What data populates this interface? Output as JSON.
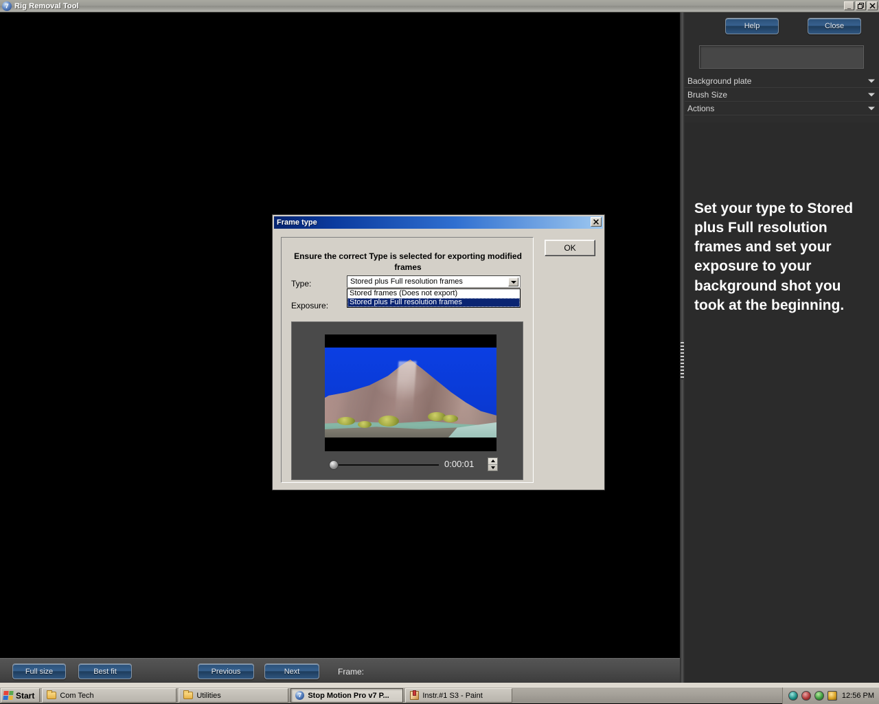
{
  "app_window": {
    "title": "Rig Removal Tool",
    "icon": "app-circle-7-icon",
    "controls": {
      "minimize": "_",
      "restore": "restore",
      "close": "close"
    }
  },
  "right_panel": {
    "buttons": {
      "help": "Help",
      "close": "Close"
    },
    "textbox_value": "",
    "textbox_placeholder": "",
    "sections": [
      {
        "label": "Background plate"
      },
      {
        "label": "Brush Size"
      },
      {
        "label": "Actions"
      }
    ],
    "instruction": "Set your type to Stored plus Full resolution frames and set your exposure to your background shot you took at the beginning."
  },
  "bottom_toolbar": {
    "full_size": "Full size",
    "best_fit": "Best fit",
    "previous": "Previous",
    "next": "Next",
    "frame_label": "Frame:",
    "frame_value": ""
  },
  "dialog": {
    "title": "Frame type",
    "close_glyph": "✕",
    "heading": "Ensure the correct Type is selected for exporting modified frames",
    "labels": {
      "type": "Type:",
      "exposure": "Exposure:"
    },
    "type_combo": {
      "value": "Stored plus Full resolution frames",
      "options": [
        "Stored frames (Does not export)",
        "Stored plus Full resolution frames"
      ],
      "selected_index": 1,
      "expanded": true
    },
    "preview": {
      "time": "0:00:01",
      "slider_position_percent": 0
    },
    "ok_button": "OK"
  },
  "taskbar": {
    "start": "Start",
    "items": [
      {
        "label": "Com Tech",
        "icon": "folder-icon",
        "active": false
      },
      {
        "label": "Utilities",
        "icon": "folder-icon",
        "active": false
      },
      {
        "label": "Stop Motion Pro v7  P...",
        "icon": "stop-motion-pro-icon",
        "active": true
      },
      {
        "label": "Instr.#1 S3 - Paint",
        "icon": "paint-icon",
        "active": false
      }
    ],
    "tray_icons": [
      "teal-disc-icon",
      "red-disc-icon",
      "green-disc-icon",
      "yellow-pencil-icon"
    ],
    "clock": "12:56 PM"
  },
  "colors": {
    "dialog_face": "#d4d0c8",
    "title_gradient_start": "#06246f",
    "title_gradient_end": "#9ec8f0",
    "selection_navy": "#0a2472",
    "panel_dark": "#2d2d2d",
    "chroma_blue": "#0b3fe3"
  }
}
